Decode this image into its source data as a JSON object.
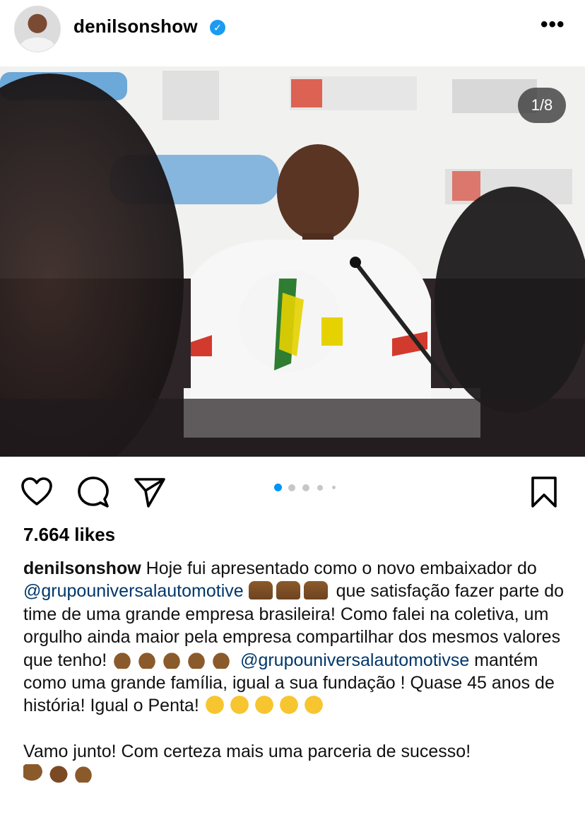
{
  "post": {
    "username": "denilsonshow",
    "verified_icon": "verified-badge-icon",
    "more_icon": "more-options-icon",
    "more_text": "•••",
    "verified_text": "✓",
    "carousel_counter": "1/8",
    "carousel_current_index": 1,
    "carousel_total": 8,
    "likes": "7.664 likes"
  },
  "actions": {
    "icons": [
      "heart-icon",
      "comment-icon",
      "share-icon",
      "bookmark-icon"
    ]
  },
  "caption": {
    "author": "denilsonshow",
    "segments": {
      "s1": " Hoje fui apresentado como o novo embaixador do ",
      "mention1": "@grupouniversalautomotive",
      "s2": " que satisfação fazer parte do time de uma grande empresa brasileira! Como falei na coletiva, um orgulho ainda maior pela empresa compartilhar dos mesmos valores que tenho!",
      "mention2": "@grupouniversalautomotivse",
      "s3": " mantém como uma grande família, igual a sua fundação ! Quase 45 anos de história! Igual o Penta!",
      "s4": "Vamo junto! Com certeza mais uma parceria de sucesso!"
    },
    "emoji": {
      "raised_hands": "raised-hands-emoji",
      "clapping": "clapping-hands-emoji",
      "laughing": "tears-of-joy-emoji",
      "muscle": "flexed-biceps-emoji",
      "fist": "oncoming-fist-emoji"
    }
  },
  "colors": {
    "mention": "#00376b",
    "active_dot": "#0095f6",
    "verified": "#1d9bf0"
  }
}
